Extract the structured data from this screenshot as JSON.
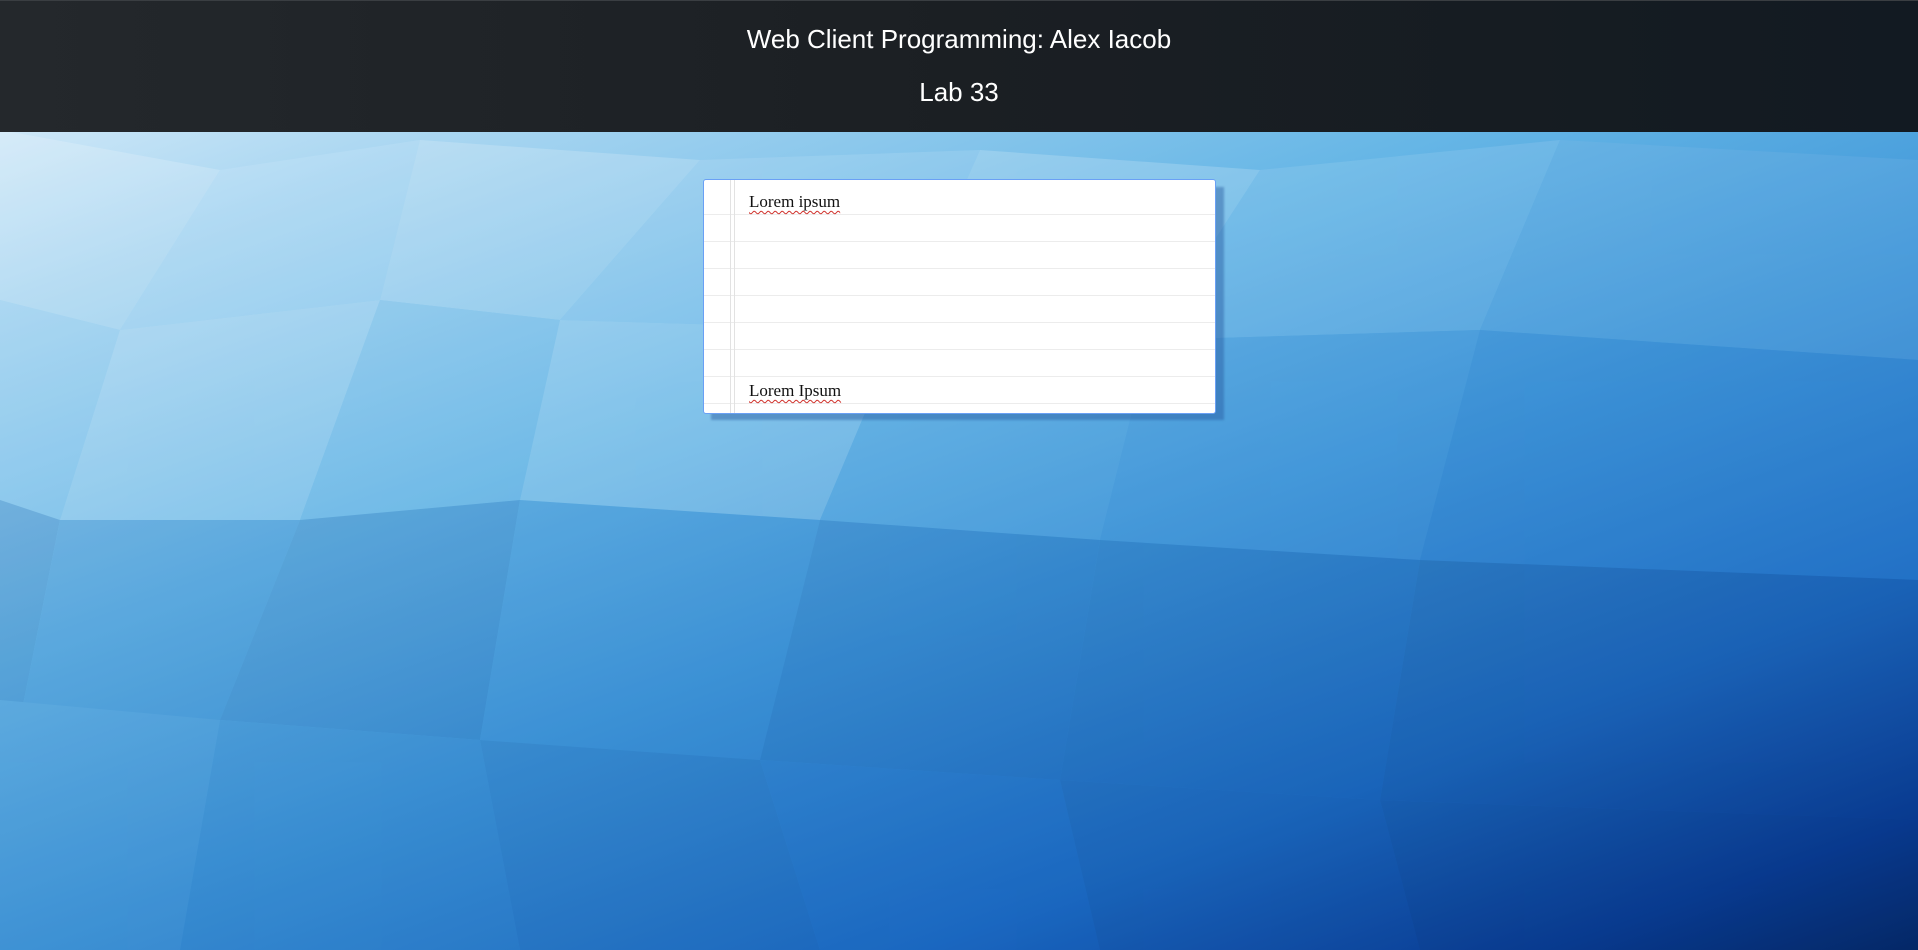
{
  "header": {
    "title": "Web Client Programming: Alex Iacob",
    "subtitle": "Lab 33"
  },
  "notepad": {
    "lines": [
      "Lorem ipsum",
      "Lorem Ipsum"
    ]
  },
  "colors": {
    "header_bg": "#1b1f23",
    "header_text": "#ffffff",
    "notepad_border": "#6aa0f5",
    "spellcheck_underline": "#d0302a"
  }
}
